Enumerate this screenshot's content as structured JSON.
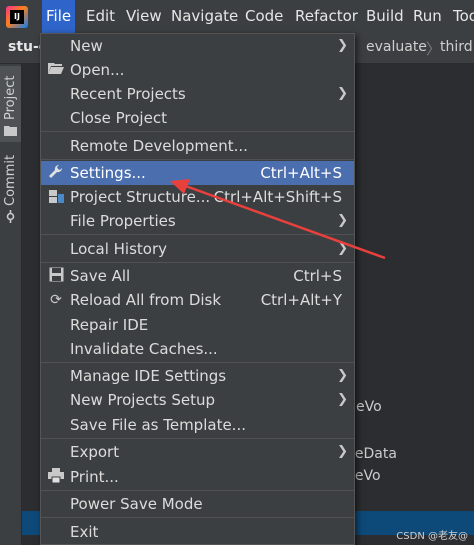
{
  "menubar": {
    "items": [
      "File",
      "Edit",
      "View",
      "Navigate",
      "Code",
      "Refactor",
      "Build",
      "Run",
      "Too"
    ]
  },
  "navbar": {
    "project": "stu-e",
    "crumbs": [
      "evaluate",
      "third"
    ]
  },
  "toolstrip": {
    "project_label": "Project",
    "commit_label": "Commit"
  },
  "editor": {
    "lines": [
      "eVo",
      "neData",
      "neVo"
    ]
  },
  "watermark": "CSDN @老友@",
  "file_menu": {
    "items": {
      "new": {
        "label": "New"
      },
      "open": {
        "label": "Open..."
      },
      "recent_projects": {
        "label": "Recent Projects"
      },
      "close_project": {
        "label": "Close Project"
      },
      "remote_development": {
        "label": "Remote Development..."
      },
      "settings": {
        "label": "Settings...",
        "shortcut": "Ctrl+Alt+S"
      },
      "project_structure": {
        "label": "Project Structure...",
        "shortcut": "Ctrl+Alt+Shift+S"
      },
      "file_properties": {
        "label": "File Properties"
      },
      "local_history": {
        "label": "Local History"
      },
      "save_all": {
        "label": "Save All",
        "shortcut": "Ctrl+S"
      },
      "reload": {
        "label": "Reload All from Disk",
        "shortcut": "Ctrl+Alt+Y"
      },
      "repair_ide": {
        "label": "Repair IDE"
      },
      "invalidate_caches": {
        "label": "Invalidate Caches..."
      },
      "manage_ide_settings": {
        "label": "Manage IDE Settings"
      },
      "new_projects_setup": {
        "label": "New Projects Setup"
      },
      "save_as_template": {
        "label": "Save File as Template..."
      },
      "export": {
        "label": "Export"
      },
      "print": {
        "label": "Print..."
      },
      "power_save_mode": {
        "label": "Power Save Mode"
      },
      "exit": {
        "label": "Exit"
      }
    }
  },
  "colors": {
    "highlight": "#4b6eaf",
    "menu_bg": "#3c3f41",
    "annotation_arrow": "#e8413d"
  }
}
